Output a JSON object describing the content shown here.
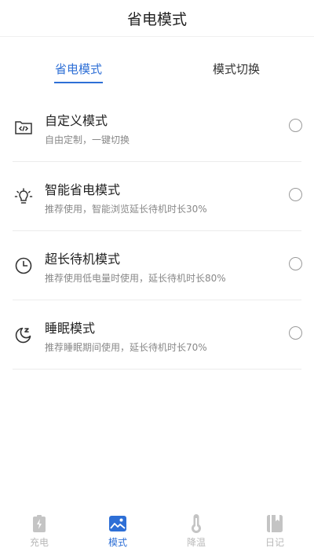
{
  "header": {
    "title": "省电模式"
  },
  "tabs": [
    {
      "label": "省电模式",
      "active": true
    },
    {
      "label": "模式切换",
      "active": false
    }
  ],
  "modes": [
    {
      "title": "自定义模式",
      "desc": "自由定制，一键切换",
      "icon": "code-folder-icon"
    },
    {
      "title": "智能省电模式",
      "desc": "推荐使用，智能浏览延长待机时长30%",
      "icon": "lightbulb-icon"
    },
    {
      "title": "超长待机模式",
      "desc": "推荐使用低电量时使用，延长待机时长80%",
      "icon": "clock-icon"
    },
    {
      "title": "睡眠模式",
      "desc": "推荐睡眠期间使用，延长待机时长70%",
      "icon": "moon-sleep-icon"
    }
  ],
  "nav": [
    {
      "label": "充电",
      "icon": "battery-charge-icon",
      "active": false
    },
    {
      "label": "模式",
      "icon": "image-mode-icon",
      "active": true
    },
    {
      "label": "降温",
      "icon": "thermometer-icon",
      "active": false
    },
    {
      "label": "日记",
      "icon": "notebook-icon",
      "active": false
    }
  ],
  "colors": {
    "accent": "#2e6fd6",
    "inactive": "#b9b9b9",
    "divider": "#ececec"
  }
}
